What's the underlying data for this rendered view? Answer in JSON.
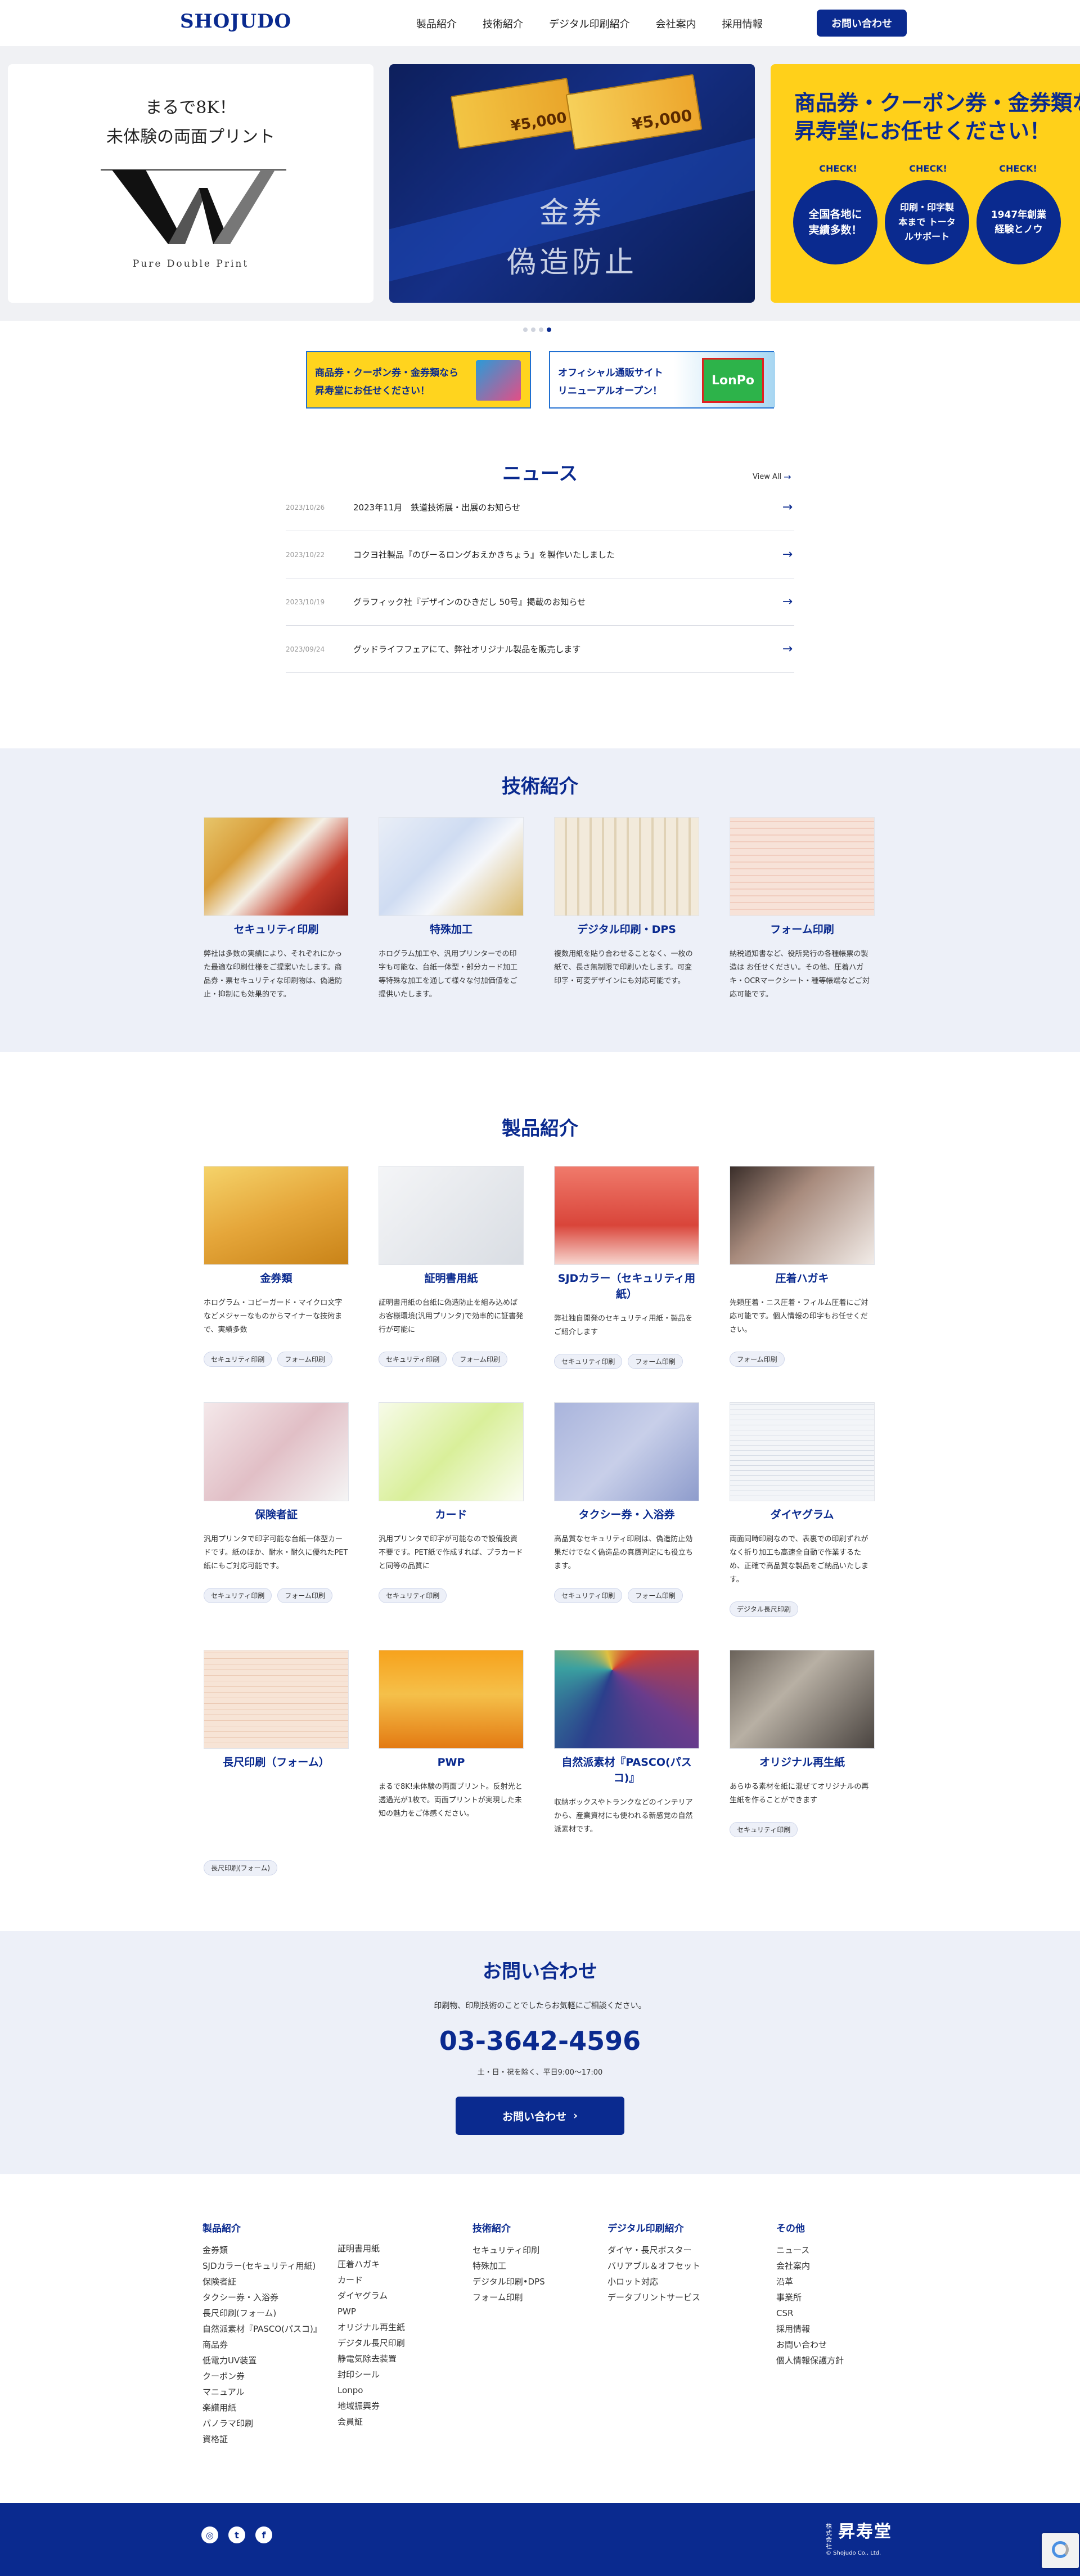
{
  "header": {
    "logo": "SHOJUDO",
    "nav": [
      "製品紹介",
      "技術紹介",
      "デジタル印刷紹介",
      "会社案内",
      "採用情報"
    ],
    "contact_button": "お問い合わせ"
  },
  "hero": {
    "slide1": {
      "line1": "まるで8K！",
      "line2": "未体験の両面プリント",
      "caption": "Pure Double Print"
    },
    "slide2": {
      "line1": "金券",
      "line2": "偽造防止",
      "ticket_value": "¥5,000"
    },
    "slide3": {
      "line1": "商品券・クーポン券・金券類な",
      "line2": "昇寿堂にお任せください！",
      "check_label": "CHECK!",
      "badge1": "全国各地に実績多数！",
      "badge2": "印刷・印字製本まで トータルサポート",
      "badge3": "1947年創業 経験とノウ"
    },
    "slide_count": 4,
    "active_slide": 4
  },
  "banners": [
    {
      "line1": "商品券・クーポン券・金券類なら",
      "line2": "昇寿堂にお任せください！"
    },
    {
      "line1": "オフィシャル通販サイト",
      "line2": "リニューアルオープン！",
      "logo": "LonPo"
    }
  ],
  "news": {
    "title": "ニュース",
    "view_all": "View All",
    "items": [
      {
        "date": "2023/10/26",
        "title": "2023年11月　鉄道技術展・出展のお知らせ"
      },
      {
        "date": "2023/10/22",
        "title": "コクヨ社製品『のびーるロングおえかきちょう』を製作いたしました"
      },
      {
        "date": "2023/10/19",
        "title": "グラフィック社『デザインのひきだし 50号』掲載のお知らせ"
      },
      {
        "date": "2023/09/24",
        "title": "グッドライフフェアにて、弊社オリジナル製品を販売します"
      }
    ]
  },
  "tech": {
    "title": "技術紹介",
    "items": [
      {
        "title": "セキュリティ印刷",
        "desc": "弊社は多数の実績により、それぞれにかった最適な印刷仕様をご提案いたします。商品券・票セキュリティな印刷物は、偽造防止・抑制にも効果的です。"
      },
      {
        "title": "特殊加工",
        "desc": "ホログラム加工や、汎用プリンターでの印字も可能な、台紙一体型・部分カード加工等特殊な加工を通して様々な付加価値をご提供いたします。"
      },
      {
        "title": "デジタル印刷・DPS",
        "desc": "複数用紙を貼り合わせることなく、一枚の紙で、長さ無制限で印刷いたします。可変印字・可変デザインにも対応可能です。"
      },
      {
        "title": "フォーム印刷",
        "desc": "納税通知書など、役所発行の各種帳票の製造は お任せください。その他、圧着ハガキ・OCRマークシート・種等帳端などご対応可能です。"
      }
    ]
  },
  "products": {
    "title": "製品紹介",
    "items": [
      {
        "title": "金券類",
        "desc": "ホログラム・コピーガード・マイクロ文字などメジャーなものからマイナーな技術まで、実績多数",
        "tags": [
          "セキュリティ印刷",
          "フォーム印刷"
        ]
      },
      {
        "title": "証明書用紙",
        "desc": "証明書用紙の台紙に偽造防止を組み込めばお客様環境(汎用プリンタ)で効率的に証書発行が可能に",
        "tags": [
          "セキュリティ印刷",
          "フォーム印刷"
        ]
      },
      {
        "title": "SJDカラー（セキュリティ用紙）",
        "desc": "弊社独自開発のセキュリティ用紙・製品をご紹介します",
        "tags": [
          "セキュリティ印刷",
          "フォーム印刷"
        ]
      },
      {
        "title": "圧着ハガキ",
        "desc": "先頼圧着・ニス圧着・フィルム圧着にご対応可能です。個人情報の印字もお任せください。",
        "tags": [
          "フォーム印刷"
        ]
      },
      {
        "title": "保険者証",
        "desc": "汎用プリンタで印字可能な台紙一体型カードです。紙のほか、耐水・耐久に優れたPET紙にもご対応可能です。",
        "tags": [
          "セキュリティ印刷",
          "フォーム印刷"
        ]
      },
      {
        "title": "カード",
        "desc": "汎用プリンタで印字が可能なので設備投資不要です。PET紙で作成すれば、プラカードと同等の品質に",
        "tags": [
          "セキュリティ印刷"
        ]
      },
      {
        "title": "タクシー券・入浴券",
        "desc": "高品質なセキュリティ印刷は、偽造防止効果だけでなく偽造品の真贋判定にも役立ちます。",
        "tags": [
          "セキュリティ印刷",
          "フォーム印刷"
        ]
      },
      {
        "title": "ダイヤグラム",
        "desc": "両面同時印刷なので、表裏での印刷ずれがなく折り加工も高速全自動で作業するため、正確で高品質な製品をご納品いたします。",
        "tags": [
          "デジタル長尺印刷"
        ]
      },
      {
        "title": "長尺印刷（フォーム）",
        "desc": "",
        "tags": [
          "長尺印刷(フォーム)"
        ]
      },
      {
        "title": "PWP",
        "desc": "まるで8K!未体験の両面プリント。反射光と透過光が1枚で。両面プリントが実現した未知の魅力をご体感ください。",
        "tags": []
      },
      {
        "title": "自然派素材『PASCO(パスコ)』",
        "desc": "収納ボックスやトランクなどのインテリアから、産業資材にも使われる新感覚の自然派素材です。",
        "tags": []
      },
      {
        "title": "オリジナル再生紙",
        "desc": "あらゆる素材を紙に混ぜてオリジナルの再生紙を作ることができます",
        "tags": [
          "セキュリティ印刷"
        ]
      }
    ]
  },
  "contact": {
    "title": "お問い合わせ",
    "lead": "印刷物、印刷技術のことでしたらお気軽にご相談ください。",
    "phone": "03-3642-4596",
    "hours": "土・日・祝を除く、平日9:00〜17:00",
    "button": "お問い合わせ"
  },
  "footer": {
    "columns": [
      {
        "head": "製品紹介",
        "links": [
          "金券類",
          "SJDカラー(セキュリティ用紙)",
          "保険者証",
          "タクシー券・入浴券",
          "長尺印刷(フォーム)",
          "自然派素材『PASCO(パスコ)』",
          "商品券",
          "低電力UV装置",
          "クーポン券",
          "マニュアル",
          "楽譜用紙",
          "パノラマ印刷",
          "資格証"
        ]
      },
      {
        "head": "",
        "links": [
          "証明書用紙",
          "圧着ハガキ",
          "カード",
          "ダイヤグラム",
          "PWP",
          "オリジナル再生紙",
          "デジタル長尺印刷",
          "静電気除去装置",
          "封印シール",
          "Lonpo",
          "地域振興券",
          "会員証"
        ]
      },
      {
        "head": "技術紹介",
        "links": [
          "セキュリティ印刷",
          "特殊加工",
          "デジタル印刷•DPS",
          "フォーム印刷"
        ]
      },
      {
        "head": "デジタル印刷紹介",
        "links": [
          "ダイヤ・長尺ポスター",
          "バリアブル＆オフセット",
          "小ロット対応",
          "データプリントサービス"
        ]
      },
      {
        "head": "その他",
        "links": [
          "ニュース",
          "会社案内",
          "沿革",
          "事業所",
          "CSR",
          "採用情報",
          "お問い合わせ",
          "個人情報保護方針"
        ]
      }
    ],
    "logo_small": "株式会社",
    "logo": "昇寿堂",
    "copyright": "© Shojudo Co., Ltd."
  },
  "colors": {
    "brand": "#0a2a8f",
    "light_bg": "#edf0f8",
    "yellow": "#ffd01a"
  }
}
